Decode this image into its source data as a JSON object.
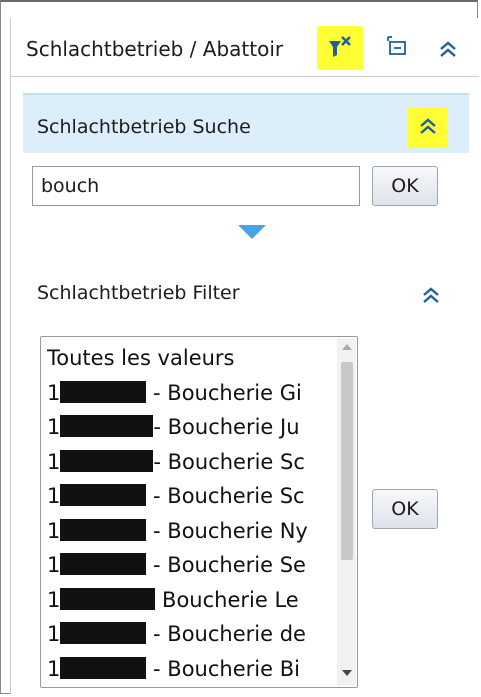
{
  "header": {
    "title": "Schlachtbetrieb / Abattoir",
    "accent_highlight": "#ffff33",
    "icons": [
      "filter-clear-icon",
      "dock-icon",
      "collapse-icon"
    ]
  },
  "search_section": {
    "title": "Schlachtbetrieb Suche",
    "input_value": "bouch",
    "ok_label": "OK",
    "header_color": "#dbeefa",
    "expand_color": "#4aa3e3"
  },
  "filter_section": {
    "title": "Schlachtbetrieb Filter",
    "ok_label": "OK",
    "items": [
      {
        "prefix": "",
        "text": "Toutes les valeurs",
        "redacted": false
      },
      {
        "prefix": "1",
        "text": " - Boucherie Gi",
        "redacted": true
      },
      {
        "prefix": "1",
        "text": "- Boucherie Ju",
        "redacted": true
      },
      {
        "prefix": "1",
        "text": "- Boucherie Sc",
        "redacted": true
      },
      {
        "prefix": "1",
        "text": " - Boucherie Sc",
        "redacted": true
      },
      {
        "prefix": "1",
        "text": " - Boucherie Ny",
        "redacted": true
      },
      {
        "prefix": "1",
        "text": " - Boucherie Se",
        "redacted": true
      },
      {
        "prefix": "1",
        "text": " Boucherie Le",
        "redacted": true
      },
      {
        "prefix": "1",
        "text": " - Boucherie de",
        "redacted": true
      },
      {
        "prefix": "1",
        "text": " - Boucherie Bi",
        "redacted": true
      }
    ]
  }
}
